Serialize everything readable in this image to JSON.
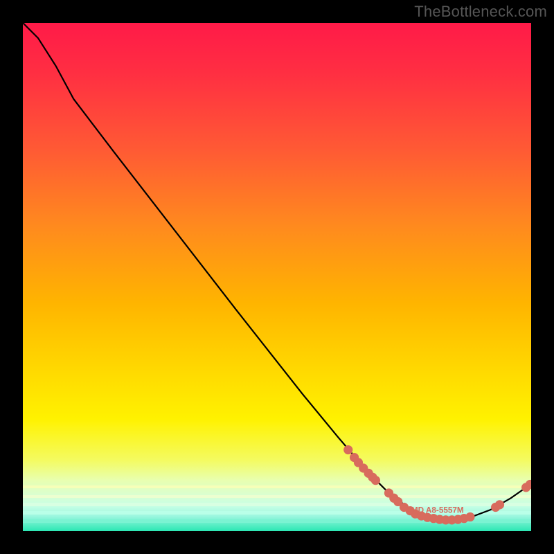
{
  "watermark": "TheBottleneck.com",
  "colors": {
    "gradient_top": "#ff1a48",
    "gradient_mid": "#ffd800",
    "gradient_bottom": "#2be7b3",
    "curve_stroke": "#000000",
    "dot_fill": "#d86b5d",
    "page_bg": "#000000"
  },
  "legend_text": "AMD A8-5557M",
  "chart_data": {
    "type": "line",
    "title": "",
    "xlabel": "",
    "ylabel": "",
    "xlim": [
      0,
      100
    ],
    "ylim": [
      0,
      100
    ],
    "grid": false,
    "legend_position": "embedded-on-curve",
    "note": "Axes are unlabeled in the original image; x/y values are read as percentage of plot width/height with y=0 at TOP (image convention). The curve is the black line; 'dots' are the salmon-colored markers overlaid along the curve near the trough and at the right edge.",
    "series": [
      {
        "name": "bottleneck-curve",
        "kind": "line",
        "points": [
          {
            "x": 0.0,
            "y": 0.0
          },
          {
            "x": 3.0,
            "y": 3.0
          },
          {
            "x": 6.5,
            "y": 8.5
          },
          {
            "x": 10.0,
            "y": 15.0
          },
          {
            "x": 18.0,
            "y": 25.5
          },
          {
            "x": 30.0,
            "y": 41.0
          },
          {
            "x": 42.0,
            "y": 56.5
          },
          {
            "x": 55.0,
            "y": 73.0
          },
          {
            "x": 62.0,
            "y": 81.5
          },
          {
            "x": 68.0,
            "y": 88.5
          },
          {
            "x": 72.0,
            "y": 92.5
          },
          {
            "x": 76.0,
            "y": 95.5
          },
          {
            "x": 80.0,
            "y": 97.3
          },
          {
            "x": 84.0,
            "y": 97.8
          },
          {
            "x": 88.0,
            "y": 97.3
          },
          {
            "x": 92.0,
            "y": 95.8
          },
          {
            "x": 96.0,
            "y": 93.5
          },
          {
            "x": 100.0,
            "y": 90.7
          }
        ]
      },
      {
        "name": "markers",
        "kind": "scatter",
        "points": [
          {
            "x": 64.0,
            "y": 84.0
          },
          {
            "x": 65.2,
            "y": 85.5
          },
          {
            "x": 66.0,
            "y": 86.5
          },
          {
            "x": 67.0,
            "y": 87.6
          },
          {
            "x": 68.0,
            "y": 88.6
          },
          {
            "x": 68.8,
            "y": 89.4
          },
          {
            "x": 69.4,
            "y": 90.0
          },
          {
            "x": 72.0,
            "y": 92.5
          },
          {
            "x": 73.0,
            "y": 93.5
          },
          {
            "x": 73.8,
            "y": 94.2
          },
          {
            "x": 75.0,
            "y": 95.3
          },
          {
            "x": 76.2,
            "y": 96.0
          },
          {
            "x": 77.2,
            "y": 96.6
          },
          {
            "x": 78.4,
            "y": 97.0
          },
          {
            "x": 79.6,
            "y": 97.3
          },
          {
            "x": 80.8,
            "y": 97.5
          },
          {
            "x": 82.0,
            "y": 97.7
          },
          {
            "x": 83.2,
            "y": 97.8
          },
          {
            "x": 84.4,
            "y": 97.8
          },
          {
            "x": 85.6,
            "y": 97.7
          },
          {
            "x": 86.8,
            "y": 97.5
          },
          {
            "x": 88.0,
            "y": 97.2
          },
          {
            "x": 93.0,
            "y": 95.3
          },
          {
            "x": 93.8,
            "y": 94.8
          },
          {
            "x": 99.0,
            "y": 91.4
          },
          {
            "x": 99.8,
            "y": 90.8
          }
        ]
      }
    ]
  }
}
